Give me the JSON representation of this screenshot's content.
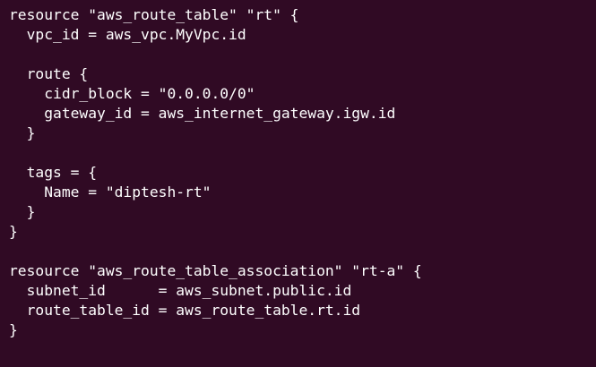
{
  "terminal": {
    "background": "#300a24",
    "foreground": "#ffffff",
    "lines": [
      "resource \"aws_route_table\" \"rt\" {",
      "  vpc_id = aws_vpc.MyVpc.id",
      "",
      "  route {",
      "    cidr_block = \"0.0.0.0/0\"",
      "    gateway_id = aws_internet_gateway.igw.id",
      "  }",
      "",
      "  tags = {",
      "    Name = \"diptesh-rt\"",
      "  }",
      "}",
      "",
      "resource \"aws_route_table_association\" \"rt-a\" {",
      "  subnet_id      = aws_subnet.public.id",
      "  route_table_id = aws_route_table.rt.id",
      "}"
    ]
  }
}
